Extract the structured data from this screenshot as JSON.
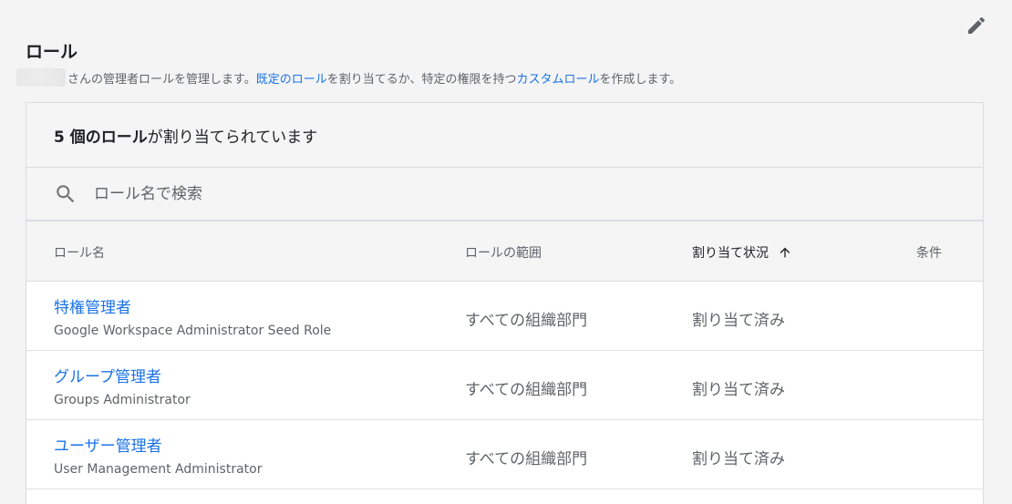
{
  "section": {
    "title": "ロール",
    "desc_prefix": "さんの管理者ロールを管理します。",
    "desc_link1": "既定のロール",
    "desc_mid": "を割り当てるか、特定の権限を持つ",
    "desc_link2": "カスタムロール",
    "desc_suffix": "を作成します。"
  },
  "card": {
    "count_bold": "5 個のロール",
    "count_rest": "が割り当てられています",
    "search_placeholder": "ロール名で検索"
  },
  "table": {
    "headers": {
      "name": "ロール名",
      "scope": "ロールの範囲",
      "status": "割り当て状況",
      "condition": "条件"
    },
    "rows": [
      {
        "name": "特権管理者",
        "sub": "Google Workspace Administrator Seed Role",
        "scope": "すべての組織部門",
        "status": "割り当て済み"
      },
      {
        "name": "グループ管理者",
        "sub": "Groups Administrator",
        "scope": "すべての組織部門",
        "status": "割り当て済み"
      },
      {
        "name": "ユーザー管理者",
        "sub": "User Management Administrator",
        "scope": "すべての組織部門",
        "status": "割り当て済み"
      }
    ]
  },
  "icons": {
    "edit": "pencil-icon",
    "search": "search-icon",
    "sort": "arrow-up-icon"
  },
  "colors": {
    "link": "#1a73e8",
    "text": "#202124",
    "muted": "#5f6368"
  }
}
